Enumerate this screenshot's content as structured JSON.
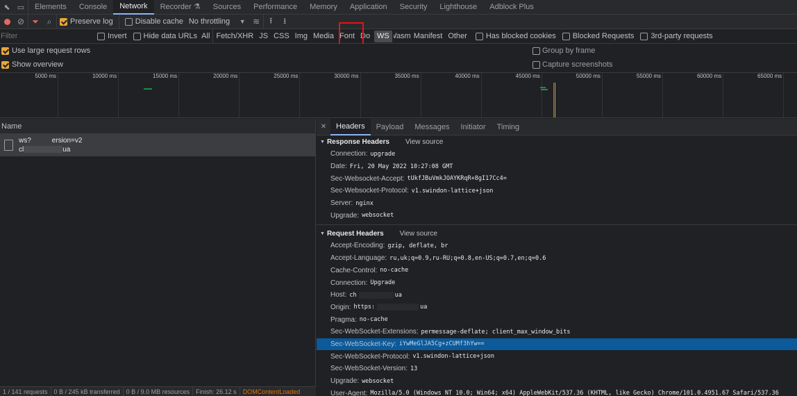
{
  "tabs": [
    "Elements",
    "Console",
    "Network",
    "Recorder",
    "Sources",
    "Performance",
    "Memory",
    "Application",
    "Security",
    "Lighthouse",
    "Adblock Plus"
  ],
  "toolbar": {
    "preserve_log": "Preserve log",
    "disable_cache": "Disable cache",
    "throttling": "No throttling"
  },
  "filterbar": {
    "placeholder": "Filter",
    "invert": "Invert",
    "hide_data_urls": "Hide data URLs",
    "types": [
      "All",
      "Fetch/XHR",
      "JS",
      "CSS",
      "Img",
      "Media",
      "Font",
      "Doc",
      "WS",
      "Wasm",
      "Manifest",
      "Other"
    ],
    "has_blocked_cookies": "Has blocked cookies",
    "blocked_requests": "Blocked Requests",
    "third_party": "3rd-party requests"
  },
  "settings": {
    "large_rows": "Use large request rows",
    "show_overview": "Show overview",
    "group_by_frame": "Group by frame",
    "capture_screenshots": "Capture screenshots"
  },
  "overview_ticks": [
    "5000 ms",
    "10000 ms",
    "15000 ms",
    "20000 ms",
    "25000 ms",
    "30000 ms",
    "35000 ms",
    "40000 ms",
    "45000 ms",
    "50000 ms",
    "55000 ms",
    "60000 ms",
    "65000 ms"
  ],
  "list": {
    "name_header": "Name",
    "request_line1_a": "ws?",
    "request_line1_b": "ersion=v2",
    "request_line2_a": "cl",
    "request_line2_b": "ua"
  },
  "status": {
    "requests": "1 / 141 requests",
    "transferred": "0 B / 245 kB transferred",
    "resources": "0 B / 9.0 MB resources",
    "finish": "Finish: 26.12 s",
    "dcl": "DOMContentLoaded"
  },
  "detail_tabs": [
    "Headers",
    "Payload",
    "Messages",
    "Initiator",
    "Timing"
  ],
  "response_headers": {
    "title": "Response Headers",
    "view_source": "View source",
    "rows": [
      {
        "k": "Connection:",
        "v": "upgrade"
      },
      {
        "k": "Date:",
        "v": "Fri, 20 May 2022 10:27:08 GMT"
      },
      {
        "k": "Sec-Websocket-Accept:",
        "v": "tUkfJBuVmkJOAYKRqR+8gI17Cc4="
      },
      {
        "k": "Sec-Websocket-Protocol:",
        "v": "v1.swindon-lattice+json"
      },
      {
        "k": "Server:",
        "v": "nginx"
      },
      {
        "k": "Upgrade:",
        "v": "websocket"
      }
    ]
  },
  "request_headers": {
    "title": "Request Headers",
    "view_source": "View source",
    "rows": [
      {
        "k": "Accept-Encoding:",
        "v": "gzip, deflate, br"
      },
      {
        "k": "Accept-Language:",
        "v": "ru,uk;q=0.9,ru-RU;q=0.8,en-US;q=0.7,en;q=0.6"
      },
      {
        "k": "Cache-Control:",
        "v": "no-cache"
      },
      {
        "k": "Connection:",
        "v": "Upgrade"
      },
      {
        "k": "Host:",
        "v": "ch",
        "v2": "ua"
      },
      {
        "k": "Origin:",
        "v": "https:",
        "v2": "ua"
      },
      {
        "k": "Pragma:",
        "v": "no-cache"
      },
      {
        "k": "Sec-WebSocket-Extensions:",
        "v": "permessage-deflate; client_max_window_bits"
      },
      {
        "k": "Sec-WebSocket-Key:",
        "v": "iYwMeGlJA5Cg+zCUMf3hYw=="
      },
      {
        "k": "Sec-WebSocket-Protocol:",
        "v": "v1.swindon-lattice+json"
      },
      {
        "k": "Sec-WebSocket-Version:",
        "v": "13"
      },
      {
        "k": "Upgrade:",
        "v": "websocket"
      },
      {
        "k": "User-Agent:",
        "v": "Mozilla/5.0 (Windows NT 10.0; Win64; x64) AppleWebKit/537.36 (KHTML, like Gecko) Chrome/101.0.4951.67 Safari/537.36"
      }
    ]
  },
  "colors": {
    "accent": "#8ab4f8",
    "selected_row": "#0c5a9a",
    "checkbox": "#e8a63a",
    "highlight_box": "#e8121b",
    "dcl": "#e37400"
  }
}
